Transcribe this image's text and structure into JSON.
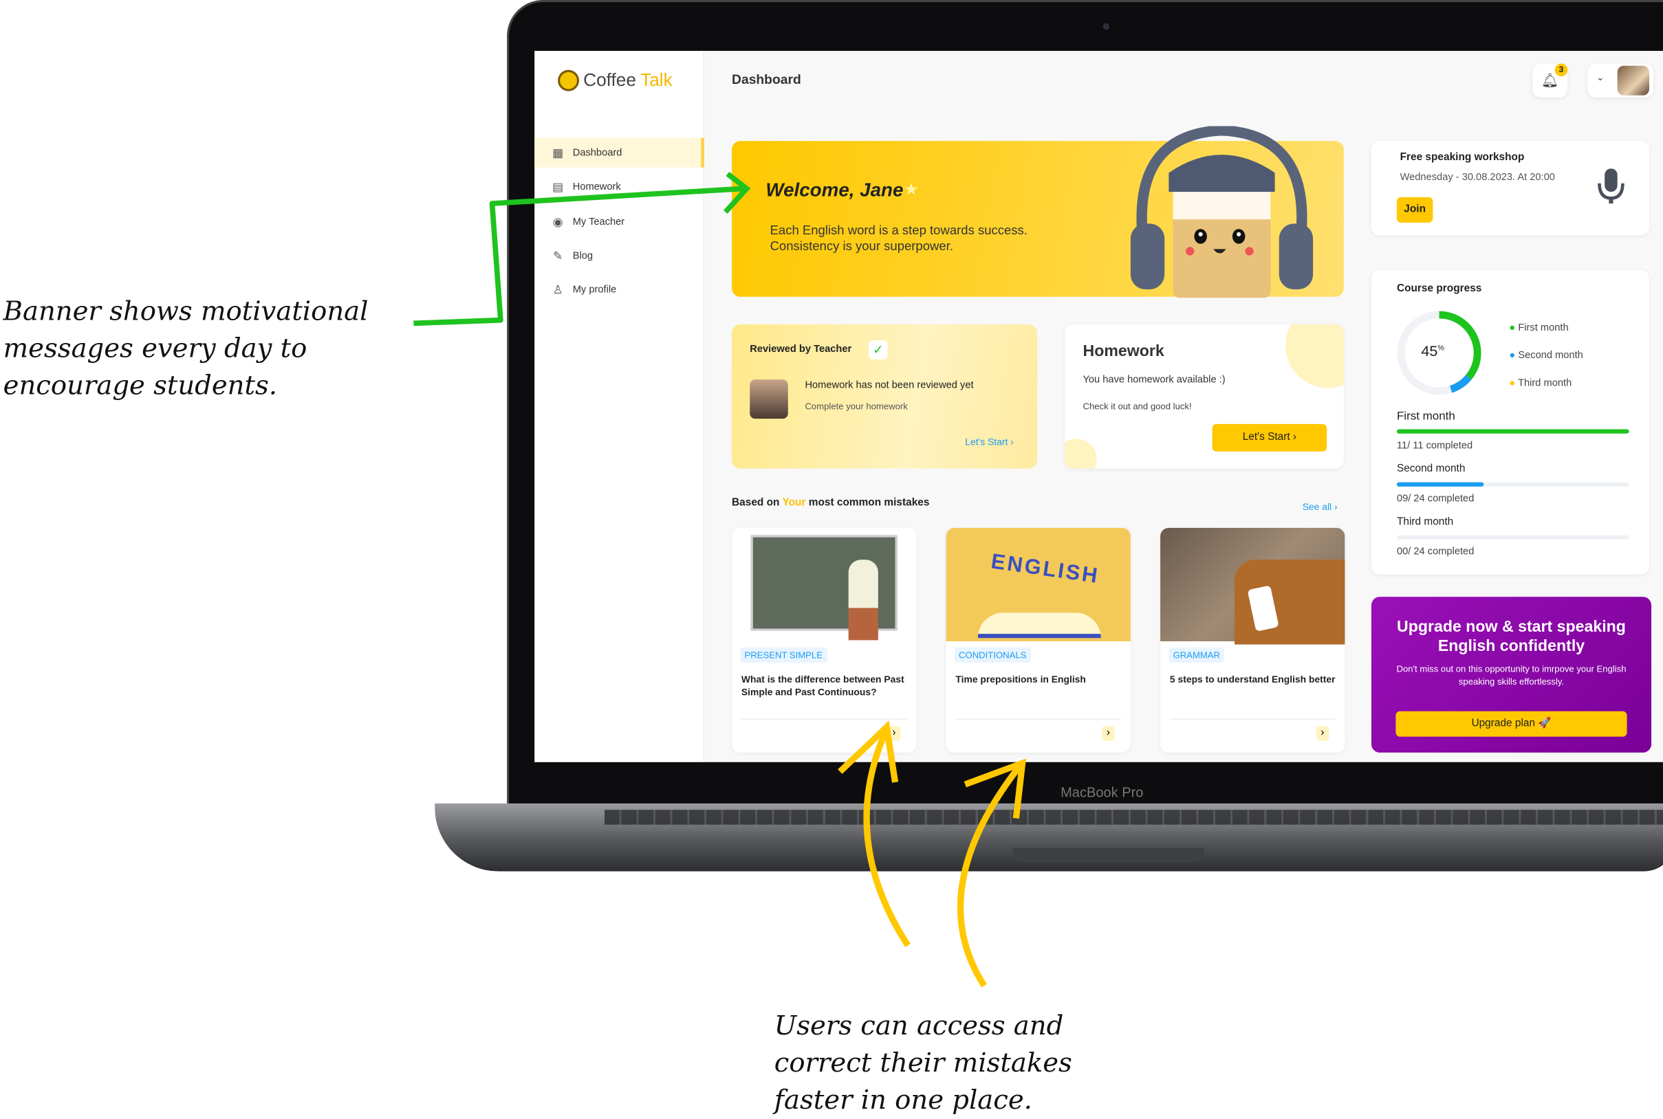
{
  "app": {
    "name_a": "Coffee",
    "name_b": "Talk",
    "page_title": "Dashboard",
    "notifications": "3"
  },
  "sidebar": {
    "items": [
      {
        "label": "Dashboard",
        "icon": "grid-icon",
        "active": true
      },
      {
        "label": "Homework",
        "icon": "document-icon"
      },
      {
        "label": "My Teacher",
        "icon": "user-circle-icon"
      },
      {
        "label": "Blog",
        "icon": "edit-icon"
      },
      {
        "label": "My profile",
        "icon": "user-icon"
      }
    ]
  },
  "banner": {
    "title": "Welcome, Jane",
    "message": "Each English word is a step towards success. Consistency is your superpower."
  },
  "workshop": {
    "title": "Free speaking workshop",
    "date": "Wednesday - 30.08.2023. At 20:00",
    "join": "Join"
  },
  "progress": {
    "title": "Course progress",
    "percent": 45,
    "percent_label": "45",
    "percent_sign": "%",
    "legend": [
      {
        "label": "First month",
        "color": "#1ec31e"
      },
      {
        "label": "Second month",
        "color": "#1a9cf0"
      },
      {
        "label": "Third month",
        "color": "#ffc800"
      }
    ],
    "months": [
      {
        "name": "First month",
        "done": 11,
        "total": 11,
        "text": "11/ 11 completed",
        "color": "#1ec31e"
      },
      {
        "name": "Second month",
        "done": 9,
        "total": 24,
        "text": "09/ 24 completed",
        "color": "#1a9cf0"
      },
      {
        "name": "Third month",
        "done": 0,
        "total": 24,
        "text": "00/ 24 completed",
        "color": "#ffc800"
      }
    ]
  },
  "upgrade": {
    "title": "Upgrade now & start speaking English confidently",
    "text": "Don't miss out on this opportunity to imrpove your English speaking skills effortlessly.",
    "button": "Upgrade plan 🚀"
  },
  "review": {
    "title": "Reviewed by Teacher",
    "status": "Homework has not been reviewed yet",
    "sub": "Complete your homework",
    "link": "Let's Start"
  },
  "homework": {
    "title": "Homework",
    "text": "You have homework available :)",
    "sub": "Check it out and good luck!",
    "button": "Let's Start"
  },
  "mistakes": {
    "pre": "Based on ",
    "your": "Your",
    "post": " most common mistakes",
    "see_all": "See all",
    "articles": [
      {
        "tag": "PRESENT SIMPLE",
        "title": "What is the difference between Past Simple and Past Continuous?"
      },
      {
        "tag": "CONDITIONALS",
        "title": "Time prepositions in English"
      },
      {
        "tag": "GRAMMAR",
        "title": "5 steps to understand English better"
      }
    ]
  },
  "device": {
    "label": "MacBook Pro"
  },
  "annotations": {
    "left": "Banner shows motivational messages every day to encourage students.",
    "bottom": "Users can access and correct their mistakes faster in one place."
  },
  "colors": {
    "accent": "#ffc800",
    "green": "#1ec31e",
    "blue": "#1a9cf0",
    "purple": "#8b00a8"
  }
}
